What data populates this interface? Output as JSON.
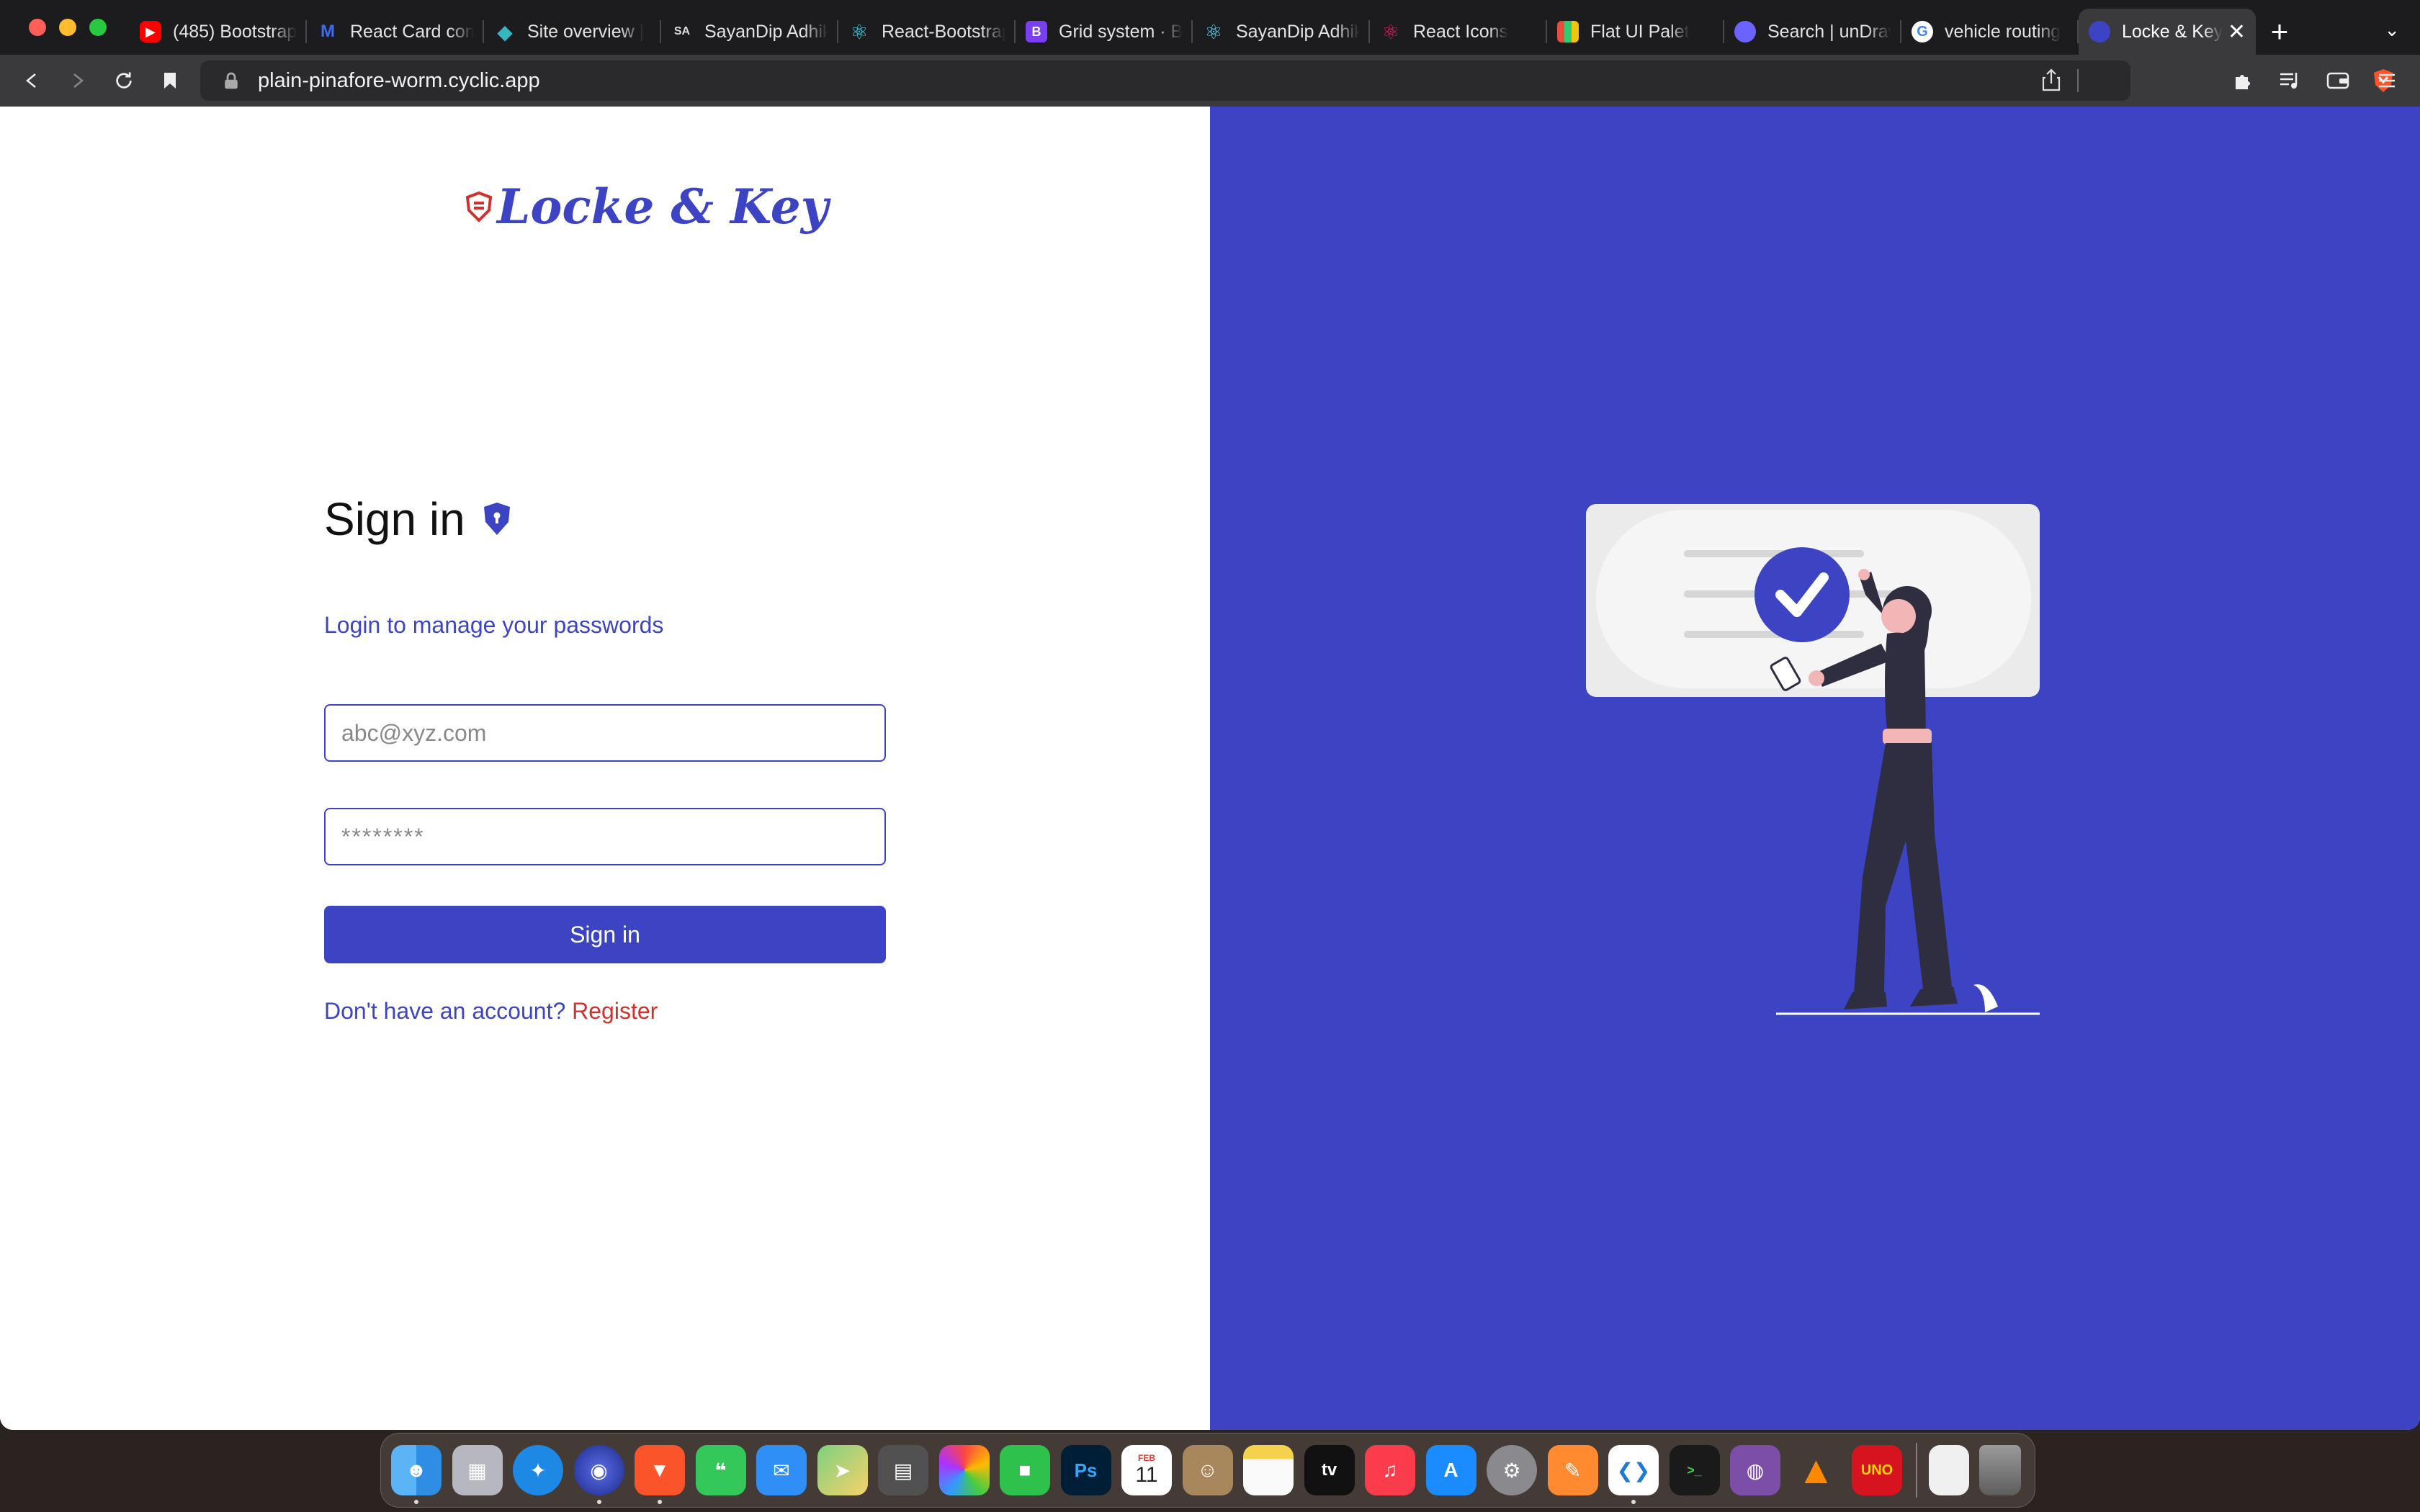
{
  "browser": {
    "tabs": [
      {
        "label": "(485) Bootstrap",
        "icon": "youtube-icon",
        "color": "#ff0000"
      },
      {
        "label": "React Card com",
        "icon": "mui-icon",
        "color": "#3b6cf6"
      },
      {
        "label": "Site overview |",
        "icon": "netlify-icon",
        "color": "#35b7c0"
      },
      {
        "label": "SayanDip Adhik",
        "icon": "sa-icon",
        "color": "#1c1c1e"
      },
      {
        "label": "React-Bootstrap",
        "icon": "react-bootstrap-icon",
        "color": "#41e0fd"
      },
      {
        "label": "Grid system · B",
        "icon": "bootstrap-icon",
        "color": "#7b3ff2"
      },
      {
        "label": "SayanDip Adhik",
        "icon": "react-icon",
        "color": "#61dafb"
      },
      {
        "label": "React Icons",
        "icon": "react-icons-icon",
        "color": "#e91e63"
      },
      {
        "label": "Flat UI Palet",
        "icon": "flatui-icon",
        "color": "#e67e22"
      },
      {
        "label": "Search | unDraw",
        "icon": "undraw-icon",
        "color": "#6c63ff"
      },
      {
        "label": "vehicle routing",
        "icon": "google-icon",
        "color": "#4285f4"
      },
      {
        "label": "Locke & Key",
        "icon": "locke-key-icon",
        "color": "#3d44c4"
      }
    ],
    "url": "plain-pinafore-worm.cyclic.app"
  },
  "brand": {
    "name": "Locke & Key",
    "color": "#3d44c4",
    "accent": "#d0312d"
  },
  "signin": {
    "title": "Sign in",
    "subtitle": "Login to manage your passwords",
    "email_placeholder": "abc@xyz.com",
    "password_placeholder": "********",
    "button_label": "Sign in",
    "register_prompt": "Don't have an account?",
    "register_link": "Register"
  },
  "dock": {
    "apps": [
      "Finder",
      "Launchpad",
      "Safari",
      "Firefox",
      "Brave",
      "Messages",
      "Mail",
      "Maps",
      "Calculator",
      "Photos",
      "FaceTime",
      "Photoshop",
      "Calendar",
      "Contacts",
      "Notes",
      "Apple TV",
      "Music",
      "App Store",
      "System Preferences",
      "Pages",
      "Visual Studio Code",
      "Terminal",
      "GitHub Desktop",
      "VLC",
      "UNO",
      "Documents",
      "Trash"
    ],
    "calendar_month": "FEB",
    "calendar_day": "11",
    "photoshop_label": "Ps",
    "tv_label": "tv"
  }
}
